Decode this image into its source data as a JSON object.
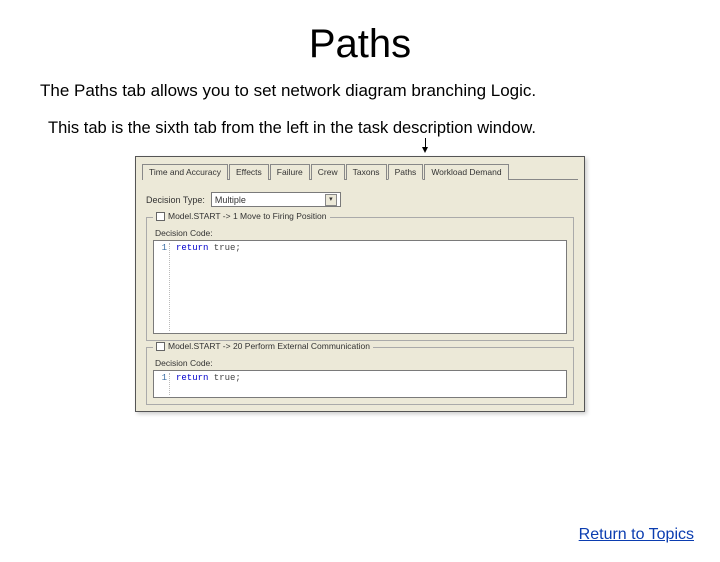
{
  "title": "Paths",
  "intro1": "The Paths tab allows you to set network diagram branching Logic.",
  "intro2": "This tab is the sixth tab from the left in the task description window.",
  "tabs": {
    "t0": "Time and Accuracy",
    "t1": "Effects",
    "t2": "Failure",
    "t3": "Crew",
    "t4": "Taxons",
    "t5": "Paths",
    "t6": "Workload Demand"
  },
  "decision_label": "Decision Type:",
  "decision_value": "Multiple",
  "group1_title": "Model.START -> 1 Move to Firing Position",
  "group2_title": "Model.START -> 20 Perform External Communication",
  "code_label": "Decision Code:",
  "code_line_num": "1",
  "code_kw": "return",
  "code_rest": " true;",
  "return_link": "Return to Topics"
}
